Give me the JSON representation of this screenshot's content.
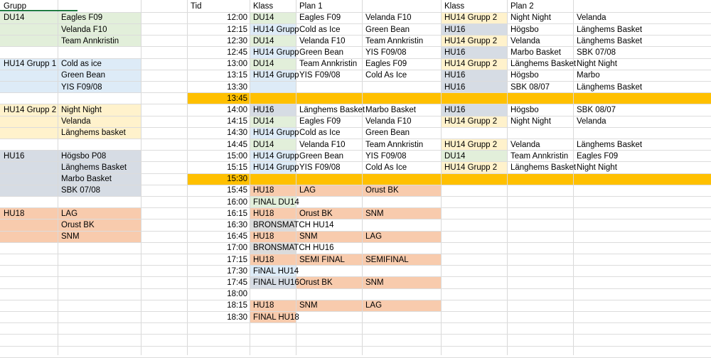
{
  "colors": {
    "DU14": "#e2efda",
    "HU14": "#ddebf7",
    "HU14G2": "#fff2cc",
    "HU16": "#d6dce4",
    "HU18": "#f8cbad",
    "BRONS": "#dbdbdb",
    "BREAK": "#ffc000"
  },
  "headers": {
    "grupp": "Grupp",
    "tid": "Tid",
    "klass1": "Klass",
    "plan1": "Plan 1",
    "klass2": "Klass",
    "plan2": "Plan 2"
  },
  "groups": [
    {
      "row": 2,
      "name": "DU14",
      "team": "Eagles F09",
      "color": "DU14"
    },
    {
      "row": 3,
      "name": "",
      "team": "Velanda F10",
      "color": "DU14"
    },
    {
      "row": 4,
      "name": "",
      "team": "Team Annkristin",
      "color": "DU14"
    },
    {
      "row": 6,
      "name": "HU14 Grupp 1",
      "team": "Cold as ice",
      "color": "HU14"
    },
    {
      "row": 7,
      "name": "",
      "team": "Green Bean",
      "color": "HU14"
    },
    {
      "row": 8,
      "name": "",
      "team": "YIS F09/08",
      "color": "HU14"
    },
    {
      "row": 10,
      "name": "HU14 Grupp 2",
      "team": "Night Night",
      "color": "HU14G2"
    },
    {
      "row": 11,
      "name": "",
      "team": "Velanda",
      "color": "HU14G2"
    },
    {
      "row": 12,
      "name": "",
      "team": "Länghems basket",
      "color": "HU14G2"
    },
    {
      "row": 14,
      "name": "HU16",
      "team": "Högsbo P08",
      "color": "HU16"
    },
    {
      "row": 15,
      "name": "",
      "team": "Länghems Basket",
      "color": "HU16"
    },
    {
      "row": 16,
      "name": "",
      "team": "Marbo Basket",
      "color": "HU16"
    },
    {
      "row": 17,
      "name": "",
      "team": "SBK 07/08",
      "color": "HU16"
    },
    {
      "row": 19,
      "name": "HU18",
      "team": "LAG",
      "color": "HU18"
    },
    {
      "row": 20,
      "name": "",
      "team": "Orust BK",
      "color": "HU18"
    },
    {
      "row": 21,
      "name": "",
      "team": "SNM",
      "color": "HU18"
    }
  ],
  "schedule": [
    {
      "row": 2,
      "time": "12:00",
      "k1": "DU14",
      "c1": "DU14",
      "h1": "Eagles F09",
      "a1": "Velanda F10",
      "k2": "HU14 Grupp 2",
      "c2": "HU14G2",
      "h2": "Night Night",
      "a2": "Velanda"
    },
    {
      "row": 3,
      "time": "12:15",
      "k1": "HU14 Grupp",
      "c1": "HU14",
      "h1": "Cold as Ice",
      "a1": "Green Bean",
      "k2": "HU16",
      "c2": "HU16",
      "h2": "Högsbo",
      "a2": "Länghems Basket"
    },
    {
      "row": 4,
      "time": "12:30",
      "k1": "DU14",
      "c1": "DU14",
      "h1": "Velanda F10",
      "a1": "Team Annkristin",
      "k2": "HU14 Grupp 2",
      "c2": "HU14G2",
      "h2": "Velanda",
      "a2": "Länghems Basket"
    },
    {
      "row": 5,
      "time": "12:45",
      "k1": "HU14 Grupp",
      "c1": "HU14",
      "h1": "Green Bean",
      "a1": "YIS F09/08",
      "k2": "HU16",
      "c2": "HU16",
      "h2": "Marbo Basket",
      "a2": "SBK 07/08"
    },
    {
      "row": 6,
      "time": "13:00",
      "k1": "DU14",
      "c1": "DU14",
      "h1": "Team Annkristin",
      "a1": "Eagles F09",
      "k2": "HU14 Grupp 2",
      "c2": "HU14G2",
      "h2": "Länghems Basket",
      "a2": "Night Night"
    },
    {
      "row": 7,
      "time": "13:15",
      "k1": "HU14 Grupp",
      "c1": "HU14",
      "h1": "YIS F09/08",
      "a1": "Cold As Ice",
      "k2": "HU16",
      "c2": "HU16",
      "h2": "Högsbo",
      "a2": "Marbo"
    },
    {
      "row": 8,
      "time": "13:30",
      "k1": "",
      "c1": "HU14",
      "h1": "",
      "a1": "",
      "k2": "HU16",
      "c2": "HU16",
      "h2": "SBK 08/07",
      "a2": "Länghems Basket"
    },
    {
      "row": 9,
      "time": "13:45",
      "break": true
    },
    {
      "row": 10,
      "time": "14:00",
      "k1": "HU16",
      "c1": "HU16",
      "h1": "Länghems Basket",
      "a1": "Marbo Basket",
      "k2": "HU16",
      "c2": "HU16",
      "h2": "Högsbo",
      "a2": "SBK 08/07"
    },
    {
      "row": 11,
      "time": "14:15",
      "k1": "DU14",
      "c1": "DU14",
      "h1": "Eagles F09",
      "a1": "Velanda F10",
      "k2": "HU14 Grupp 2",
      "c2": "HU14G2",
      "h2": "Night Night",
      "a2": "Velanda"
    },
    {
      "row": 12,
      "time": "14:30",
      "k1": "HU14 Grupp",
      "c1": "HU14",
      "h1": "Cold as Ice",
      "a1": "Green Bean",
      "k2": "",
      "c2": "",
      "h2": "",
      "a2": ""
    },
    {
      "row": 13,
      "time": "14:45",
      "k1": "DU14",
      "c1": "DU14",
      "h1": "Velanda F10",
      "a1": "Team Annkristin",
      "k2": "HU14 Grupp 2",
      "c2": "HU14G2",
      "h2": "Velanda",
      "a2": "Länghems Basket"
    },
    {
      "row": 14,
      "time": "15:00",
      "k1": "HU14 Grupp",
      "c1": "HU14",
      "h1": "Green Bean",
      "a1": "YIS F09/08",
      "k2": "DU14",
      "c2": "DU14",
      "h2": "Team Annkristin",
      "a2": "Eagles F09"
    },
    {
      "row": 15,
      "time": "15:15",
      "k1": "HU14 Grupp",
      "c1": "HU14",
      "h1": "YIS F09/08",
      "a1": "Cold As Ice",
      "k2": "HU14 Grupp 2",
      "c2": "HU14G2",
      "h2": "Länghems Basket",
      "a2": "Night Night"
    },
    {
      "row": 16,
      "time": "15:30",
      "break": true
    },
    {
      "row": 17,
      "time": "15:45",
      "k1": "HU18",
      "c1": "HU18",
      "h1": "LAG",
      "a1": "Orust BK",
      "hl": "HU18"
    },
    {
      "row": 18,
      "time": "16:00",
      "k1": "FINAL DU14",
      "c1": "DU14",
      "h1": "",
      "a1": ""
    },
    {
      "row": 19,
      "time": "16:15",
      "k1": "HU18",
      "c1": "HU18",
      "h1": "Orust BK",
      "a1": "SNM",
      "hl": "HU18"
    },
    {
      "row": 20,
      "time": "16:30",
      "k1": "BRONSMATCH HU14",
      "c1": "BRONS",
      "h1": "",
      "a1": ""
    },
    {
      "row": 21,
      "time": "16:45",
      "k1": "HU18",
      "c1": "HU18",
      "h1": "SNM",
      "a1": "LAG",
      "hl": "HU18"
    },
    {
      "row": 22,
      "time": "17:00",
      "k1": "BRONSMATCH HU16",
      "c1": "BRONS",
      "h1": "",
      "a1": ""
    },
    {
      "row": 23,
      "time": "17:15",
      "k1": "HU18",
      "c1": "HU18",
      "h1": "SEMI FINAL",
      "a1": "SEMIFINAL",
      "hl": "HU18"
    },
    {
      "row": 24,
      "time": "17:30",
      "k1": "FiNAL HU14",
      "c1": "HU14",
      "h1": "",
      "a1": ""
    },
    {
      "row": 25,
      "time": "17:45",
      "k1": "FINAL HU16",
      "c1": "HU16",
      "h1": "Orust BK",
      "a1": "SNM",
      "hl": "HU18"
    },
    {
      "row": 26,
      "time": "18:00",
      "k1": "",
      "c1": "",
      "h1": "",
      "a1": ""
    },
    {
      "row": 27,
      "time": "18:15",
      "k1": "HU18",
      "c1": "HU18",
      "h1": "SNM",
      "a1": "LAG",
      "hl": "HU18"
    },
    {
      "row": 28,
      "time": "18:30",
      "k1": "FINAL HU18",
      "c1": "HU18",
      "h1": "",
      "a1": ""
    }
  ]
}
